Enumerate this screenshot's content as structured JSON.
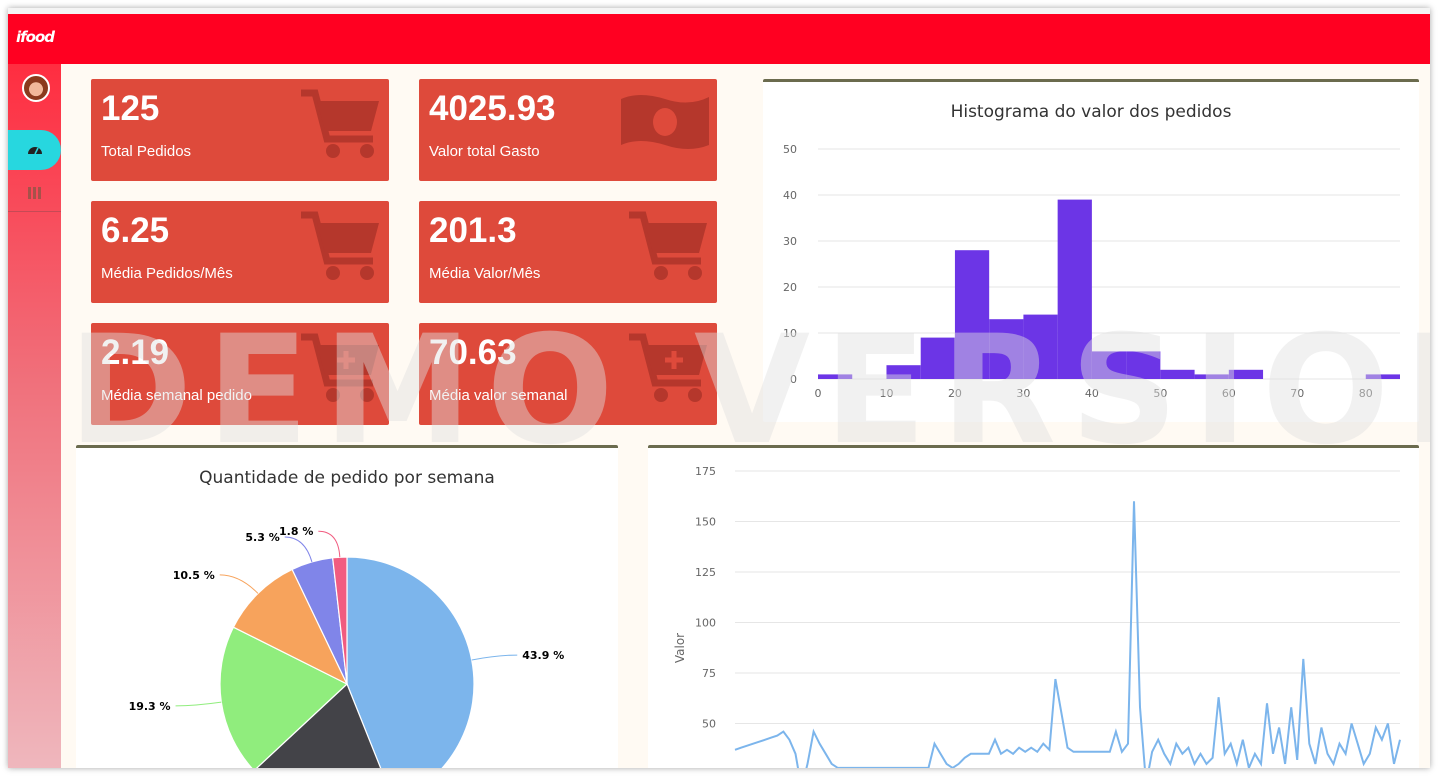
{
  "app": {
    "logo_text": "ifood",
    "watermark": "DEMO VERSION"
  },
  "sidebar": {
    "items": [
      {
        "icon": "dashboard-icon",
        "active": true
      },
      {
        "icon": "table-icon",
        "active": false
      }
    ]
  },
  "cards": [
    {
      "value": "125",
      "label": "Total Pedidos",
      "icon": "cart-icon"
    },
    {
      "value": "4025.93",
      "label": "Valor total Gasto",
      "icon": "money-icon"
    },
    {
      "value": "6.25",
      "label": "Média Pedidos/Mês",
      "icon": "cart-icon"
    },
    {
      "value": "201.3",
      "label": "Média Valor/Mês",
      "icon": "cart-icon"
    },
    {
      "value": "2.19",
      "label": "Média semanal pedido",
      "icon": "cart-plus-icon"
    },
    {
      "value": "70.63",
      "label": "Média valor semanal",
      "icon": "cart-plus-icon"
    }
  ],
  "colors": {
    "topbar": "#ff0021",
    "card": "#de4a3b",
    "histogram": "#6c35e6",
    "line": "#7cb5ec"
  },
  "chart_data": [
    {
      "type": "bar",
      "title": "Histograma do valor dos pedidos",
      "bin_edges": [
        0,
        5,
        10,
        15,
        20,
        25,
        30,
        35,
        40,
        45,
        50,
        55,
        60,
        65,
        70,
        75,
        80,
        85
      ],
      "values": [
        1,
        0,
        3,
        9,
        28,
        13,
        14,
        39,
        6,
        6,
        2,
        1,
        2,
        0,
        0,
        0,
        1
      ],
      "xticks": [
        "0",
        "10",
        "20",
        "30",
        "40",
        "50",
        "60",
        "70",
        "80"
      ],
      "yticks": [
        "0",
        "10",
        "20",
        "30",
        "40",
        "50"
      ],
      "ylim": [
        0,
        50
      ],
      "grid": true
    },
    {
      "type": "pie",
      "title": "Quantidade de pedido por semana",
      "slices": [
        {
          "value": 43.9,
          "label": "43.9 %",
          "color": "#7cb5ec"
        },
        {
          "value": 19.1,
          "label": "",
          "color": "#434348"
        },
        {
          "value": 19.3,
          "label": "19.3 %",
          "color": "#90ed7d"
        },
        {
          "value": 10.5,
          "label": "10.5 %",
          "color": "#f7a35c"
        },
        {
          "value": 5.3,
          "label": "5.3 %",
          "color": "#8085e9"
        },
        {
          "value": 1.8,
          "label": "1.8 %",
          "color": "#f15c80"
        }
      ]
    },
    {
      "type": "line",
      "ylabel": "Valor",
      "yticks": [
        "50",
        "75",
        "100",
        "125",
        "150",
        "175"
      ],
      "ylim": [
        25,
        175
      ],
      "values": [
        37,
        38,
        39,
        40,
        41,
        42,
        43,
        44,
        46,
        42,
        35,
        18,
        30,
        46,
        40,
        35,
        30,
        28,
        28,
        28,
        28,
        28,
        28,
        28,
        28,
        28,
        28,
        28,
        28,
        28,
        28,
        28,
        28,
        40,
        35,
        30,
        28,
        30,
        33,
        35,
        35,
        35,
        35,
        42,
        35,
        37,
        35,
        38,
        36,
        38,
        36,
        40,
        37,
        72,
        55,
        38,
        36,
        36,
        36,
        36,
        36,
        36,
        36,
        46,
        36,
        40,
        160,
        58,
        20,
        36,
        42,
        35,
        30,
        40,
        35,
        38,
        30,
        35,
        30,
        33,
        63,
        35,
        40,
        30,
        42,
        28,
        35,
        30,
        60,
        35,
        48,
        30,
        58,
        32,
        82,
        40,
        30,
        48,
        35,
        30,
        40,
        35,
        50,
        40,
        30,
        35,
        48,
        42,
        50,
        30,
        42
      ]
    }
  ]
}
